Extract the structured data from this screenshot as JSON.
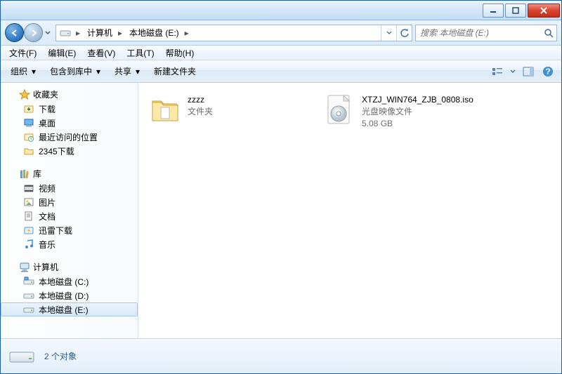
{
  "window_controls": {
    "minimize_tip": "最小化",
    "maximize_tip": "最大化",
    "close_tip": "关闭"
  },
  "breadcrumbs": {
    "root": "计算机",
    "current": "本地磁盘 (E:)"
  },
  "search": {
    "placeholder": "搜索 本地磁盘 (E:)"
  },
  "menu": {
    "file": "文件(F)",
    "edit": "编辑(E)",
    "view": "查看(V)",
    "tools": "工具(T)",
    "help": "帮助(H)"
  },
  "commands": {
    "organize": "组织",
    "include": "包含到库中",
    "share": "共享",
    "newfolder": "新建文件夹"
  },
  "sidebar": {
    "favorites": {
      "label": "收藏夹",
      "items": [
        {
          "label": "下载",
          "icon": "download"
        },
        {
          "label": "桌面",
          "icon": "desktop"
        },
        {
          "label": "最近访问的位置",
          "icon": "recent"
        },
        {
          "label": "2345下载",
          "icon": "folder"
        }
      ]
    },
    "libraries": {
      "label": "库",
      "items": [
        {
          "label": "视频",
          "icon": "video"
        },
        {
          "label": "图片",
          "icon": "pictures"
        },
        {
          "label": "文档",
          "icon": "documents"
        },
        {
          "label": "迅雷下载",
          "icon": "thunder"
        },
        {
          "label": "音乐",
          "icon": "music"
        }
      ]
    },
    "computer": {
      "label": "计算机",
      "items": [
        {
          "label": "本地磁盘 (C:)",
          "icon": "drive-sys"
        },
        {
          "label": "本地磁盘 (D:)",
          "icon": "drive"
        },
        {
          "label": "本地磁盘 (E:)",
          "icon": "drive",
          "selected": true
        }
      ]
    }
  },
  "files": [
    {
      "name": "zzzz",
      "type": "文件夹",
      "icon": "folder-large"
    },
    {
      "name": "XTZJ_WIN764_ZJB_0808.iso",
      "type": "光盘映像文件",
      "size": "5.08 GB",
      "icon": "iso"
    }
  ],
  "status": {
    "count_label": "2 个对象"
  }
}
